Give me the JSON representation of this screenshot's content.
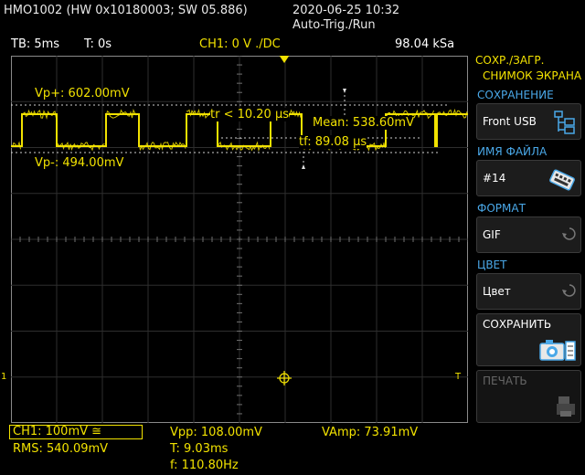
{
  "header": {
    "device": "HMO1002 (HW 0x10180003; SW 05.886)",
    "datetime": "2020-06-25 10:32",
    "trigger_mode": "Auto-Trig./Run"
  },
  "infobar": {
    "timebase": "TB: 5ms",
    "trigger_time": "T: 0s",
    "channel": "CH1: 0 V ./DC",
    "sample_rate": "98.04 kSa"
  },
  "screen": {
    "cursor_vp_plus": "Vp+: 602.00mV",
    "cursor_vp_minus": "Vp-: 494.00mV",
    "rise_time": "tr < 10.20 µs",
    "fall_time": "tf: 89.08 µs",
    "mean": "Mean: 538.60mV",
    "ch1_marker": "1",
    "trigger_marker": "T"
  },
  "side_menu": {
    "title_line1": "СОХР./ЗАГР.",
    "title_line2": "СНИМОК ЭКРАНА",
    "save_to_label": "СОХРАНЕНИЕ",
    "save_to_value": "Front USB",
    "filename_label": "ИМЯ ФАЙЛА",
    "filename_value": "#14",
    "format_label": "ФОРМАТ",
    "format_value": "GIF",
    "color_label": "ЦВЕТ",
    "color_value": "Цвет",
    "save_button": "СОХРАНИТЬ",
    "print_button": "ПЕЧАТЬ",
    "accent_color": "#4aa8e8"
  },
  "bottom": {
    "ch1_scale": "CH1: 100mV ≅",
    "rms": "RMS: 540.09mV",
    "vpp": "Vpp: 108.00mV",
    "period": "T: 9.03ms",
    "freq": "f: 110.80Hz",
    "vamp": "VAmp: 73.91mV"
  },
  "colors": {
    "trace": "#f2e200",
    "grid": "#3a3a3a",
    "background": "#000000"
  }
}
